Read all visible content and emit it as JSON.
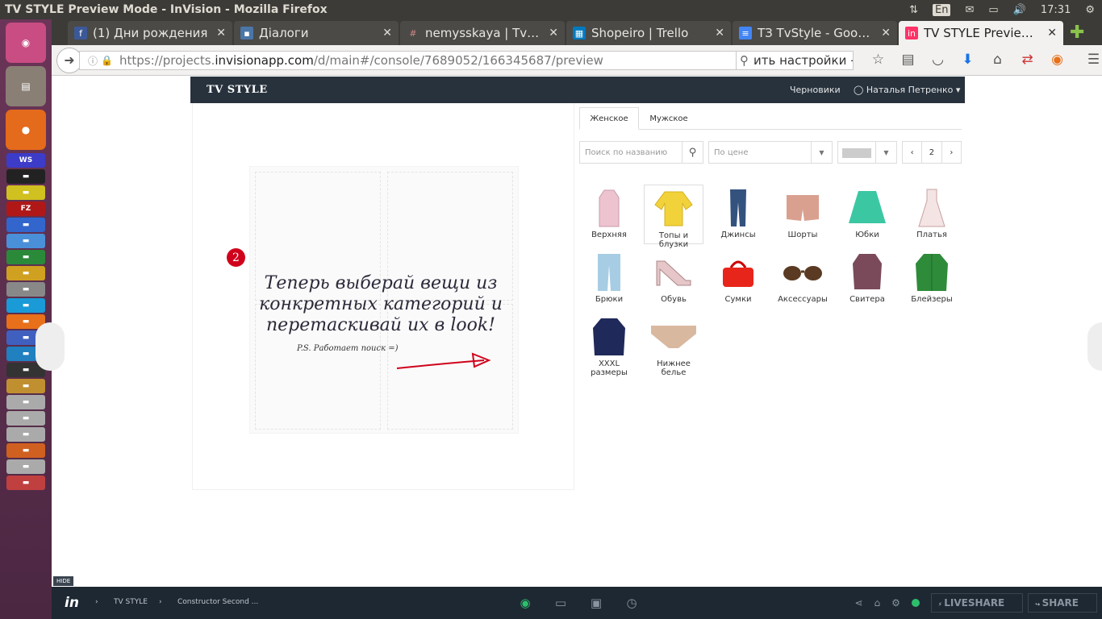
{
  "system": {
    "window_title": "TV STYLE Preview Mode - InVision - Mozilla Firefox",
    "lang": "En",
    "time": "17:31"
  },
  "launcher": {
    "items": [
      "ubuntu-icon",
      "files-icon",
      "firefox-icon",
      "webstorm-icon",
      "app-icon",
      "app-icon",
      "filezilla-icon",
      "app-icon",
      "app-icon",
      "app-icon",
      "app-icon",
      "app-icon",
      "app-icon",
      "app-icon",
      "app-icon",
      "app-icon",
      "app-icon",
      "app-icon",
      "app-icon",
      "app-icon",
      "app-icon",
      "app-icon",
      "app-icon",
      "app-icon"
    ]
  },
  "browser": {
    "tabs": [
      {
        "label": "(1) Дни рождения",
        "icon": "f",
        "color": "#3b5998"
      },
      {
        "label": "Діалоги",
        "icon": "▪",
        "color": "#4a76a8"
      },
      {
        "label": "nemysskaya | TvStyl…",
        "icon": "#",
        "color": "#4a4a46"
      },
      {
        "label": "Shopeiro | Trello",
        "icon": "▦",
        "color": "#0079bf"
      },
      {
        "label": "ТЗ TvStyle - Google …",
        "icon": "≡",
        "color": "#4285f4"
      },
      {
        "label": "TV STYLE Preview …",
        "icon": "in",
        "color": "#ff3366"
      }
    ],
    "url_prefix": "https://projects.",
    "url_domain": "invisionapp.com",
    "url_path": "/d/main#/console/7689052/166345687/preview",
    "search_text": "ить настройки →"
  },
  "app": {
    "logo": "TV STYLE",
    "drafts": "Черновики",
    "user": "Наталья Петренко",
    "badge": "2",
    "hint": "Теперь выберай вещи из конкретных категорий и перетаскивай их в look!",
    "ps": "P.S. Работает поиск =)",
    "tabs": [
      "Женское",
      "Мужское"
    ],
    "search_placeholder": "Поиск по названию",
    "price_placeholder": "По цене",
    "page": "2",
    "categories": [
      "Верхняя",
      "Топы и блузки",
      "Джинсы",
      "Шорты",
      "Юбки",
      "Платья",
      "Брюки",
      "Обувь",
      "Сумки",
      "Аксессуары",
      "Свитера",
      "Блейзеры",
      "XXXL размеры",
      "Нижнее белье"
    ]
  },
  "invision_bar": {
    "hide": "HIDE",
    "crumb1": "TV STYLE",
    "crumb2": "Constructor Second ...",
    "liveshare": "LIVESHARE",
    "share": "SHARE"
  }
}
